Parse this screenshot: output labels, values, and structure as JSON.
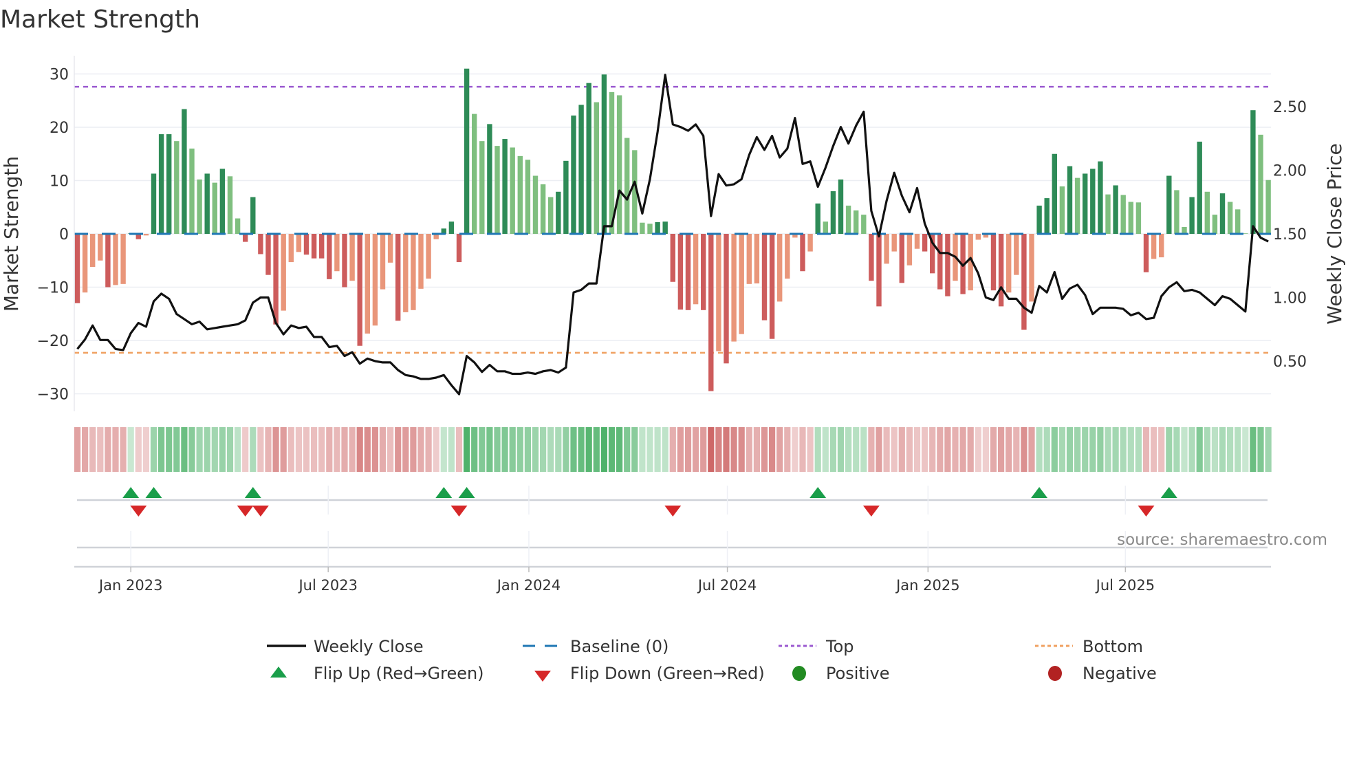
{
  "title": "Market Strength",
  "source": "source: sharemaestro.com",
  "colors": {
    "pos_strong": "#2e8b57",
    "pos_weak": "#7fbf7f",
    "neg_strong": "#cd5c5c",
    "neg_weak": "#e9967a",
    "close": "#111111",
    "baseline": "#1f77b4",
    "top": "#9b59d0",
    "bottom": "#f0a060",
    "flip_up": "#1a9e4a",
    "flip_down": "#d62728",
    "positive": "#228b22",
    "negative": "#b22222"
  },
  "chart_data": {
    "type": "bar",
    "title": "Market Strength",
    "xlabel": "",
    "ylabel": "Market Strength",
    "y2label": "Weekly Close Price",
    "ylim": [
      -33,
      33
    ],
    "y2lim": [
      0.14,
      2.83
    ],
    "yticks": [
      "30",
      "20",
      "10",
      "0",
      "−10",
      "−20",
      "−30"
    ],
    "ytick_values": [
      30,
      20,
      10,
      0,
      -10,
      -20,
      -30
    ],
    "y2ticks": [
      "2.50",
      "2.00",
      "1.50",
      "1.00",
      "0.50"
    ],
    "y2tick_values": [
      2.5,
      2.0,
      1.5,
      1.0,
      0.5
    ],
    "xticks": [
      "Jan 2023",
      "Jul 2023",
      "Jan 2024",
      "Jul 2024",
      "Jan 2025",
      "Jul 2025"
    ],
    "xtick_dates": [
      "2023-01-01",
      "2023-07-01",
      "2024-01-01",
      "2024-07-01",
      "2025-01-01",
      "2025-07-01"
    ],
    "start_week": "2022-11-13",
    "frequency": "weekly",
    "top_level": 27.6,
    "bottom_level": -22.3,
    "baseline": 0,
    "strength": [
      -13,
      -11,
      -6.2,
      -5,
      -10,
      -9.6,
      -9.4,
      0.1,
      -1,
      -0.3,
      11.3,
      18.7,
      18.7,
      17.4,
      23.4,
      16,
      10.2,
      11.3,
      9.6,
      12.2,
      10.8,
      2.9,
      -1.5,
      6.9,
      -3.8,
      -7.7,
      -17,
      -14.4,
      -5.3,
      -3.4,
      -3.9,
      -4.6,
      -4.6,
      -8.5,
      -7,
      -10,
      -8.8,
      -21,
      -18.7,
      -17.2,
      -10.4,
      -5.4,
      -16.3,
      -14.7,
      -14.3,
      -10.3,
      -8.4,
      -1,
      1,
      2.3,
      -5.3,
      31,
      22.5,
      17.4,
      20.6,
      16.5,
      17.8,
      16.2,
      14.6,
      13.9,
      10.9,
      9.3,
      6.9,
      7.9,
      13.7,
      22.2,
      24.2,
      28.3,
      24.7,
      29.9,
      26.6,
      26,
      18,
      15.7,
      2.1,
      1.9,
      2.2,
      2.3,
      -9,
      -14.2,
      -14.3,
      -13.2,
      -14.3,
      -29.5,
      -22,
      -24.3,
      -20.2,
      -18.8,
      -9.4,
      -9.3,
      -16.2,
      -19.7,
      -12.7,
      -8.4,
      -0.7,
      -7,
      -3.3,
      5.7,
      2.3,
      8,
      10.2,
      5.3,
      4.4,
      3.6,
      -8.8,
      -13.6,
      -5.6,
      -3.3,
      -9.2,
      -5.9,
      -2.8,
      -3.3,
      -7.4,
      -10.4,
      -11.7,
      -8.8,
      -11.3,
      -10.6,
      -1.1,
      -0.7,
      -10.6,
      -13.6,
      -11,
      -7.7,
      -18,
      -12.7,
      5.3,
      6.7,
      15,
      8.9,
      12.7,
      10.5,
      11.3,
      12.2,
      13.6,
      7.4,
      9.1,
      7.3,
      6,
      5.9,
      -7.2,
      -4.7,
      -4.4,
      10.9,
      8.2,
      1.3,
      6.9,
      17.3,
      7.9,
      3.6,
      7.6,
      6,
      4.6,
      0.1,
      23.2,
      18.6,
      10.1
    ],
    "weekly_close": [
      0.595,
      0.67,
      0.78,
      0.666,
      0.666,
      0.595,
      0.587,
      0.72,
      0.8,
      0.77,
      0.97,
      1.03,
      0.99,
      0.87,
      0.83,
      0.79,
      0.81,
      0.75,
      0.76,
      0.77,
      0.78,
      0.79,
      0.82,
      0.96,
      1.0,
      1.0,
      0.8,
      0.71,
      0.78,
      0.76,
      0.77,
      0.69,
      0.69,
      0.61,
      0.62,
      0.54,
      0.57,
      0.48,
      0.52,
      0.5,
      0.49,
      0.49,
      0.43,
      0.39,
      0.38,
      0.36,
      0.36,
      0.37,
      0.39,
      0.31,
      0.24,
      0.54,
      0.49,
      0.415,
      0.47,
      0.42,
      0.42,
      0.4,
      0.4,
      0.41,
      0.4,
      0.42,
      0.43,
      0.41,
      0.45,
      1.04,
      1.06,
      1.11,
      1.11,
      1.56,
      1.56,
      1.84,
      1.77,
      1.91,
      1.66,
      1.93,
      2.3,
      2.75,
      2.36,
      2.34,
      2.31,
      2.36,
      2.27,
      1.64,
      1.97,
      1.88,
      1.89,
      1.93,
      2.12,
      2.26,
      2.16,
      2.27,
      2.1,
      2.17,
      2.41,
      2.05,
      2.07,
      1.87,
      2.02,
      2.19,
      2.34,
      2.21,
      2.35,
      2.46,
      1.68,
      1.48,
      1.76,
      1.98,
      1.8,
      1.67,
      1.86,
      1.58,
      1.43,
      1.35,
      1.35,
      1.32,
      1.25,
      1.31,
      1.19,
      1.0,
      0.98,
      1.08,
      0.99,
      0.99,
      0.92,
      0.88,
      1.09,
      1.04,
      1.2,
      0.99,
      1.07,
      1.1,
      1.02,
      0.87,
      0.92,
      0.92,
      0.92,
      0.91,
      0.86,
      0.88,
      0.83,
      0.84,
      1.01,
      1.08,
      1.12,
      1.05,
      1.06,
      1.04,
      0.99,
      0.94,
      1.01,
      0.99,
      0.94,
      0.89,
      1.56,
      1.47,
      1.44
    ],
    "flip_up_weeks": [
      8,
      11,
      24,
      49,
      52,
      98,
      127,
      144
    ],
    "flip_down_weeks": [
      9,
      23,
      25,
      51,
      79,
      105,
      141
    ],
    "legend": {
      "placement": "bottom",
      "items": [
        {
          "label": "Weekly Close",
          "symbol": "line"
        },
        {
          "label": "Baseline (0)",
          "symbol": "dashed"
        },
        {
          "label": "Top",
          "symbol": "dotted-top"
        },
        {
          "label": "Bottom",
          "symbol": "dotted-bottom"
        },
        {
          "label": "Flip Up (Red→Green)",
          "symbol": "triangle-up"
        },
        {
          "label": "Flip Down (Green→Red)",
          "symbol": "triangle-down"
        },
        {
          "label": "Positive",
          "symbol": "dot-positive"
        },
        {
          "label": "Negative",
          "symbol": "dot-negative"
        }
      ]
    },
    "grid": true
  }
}
